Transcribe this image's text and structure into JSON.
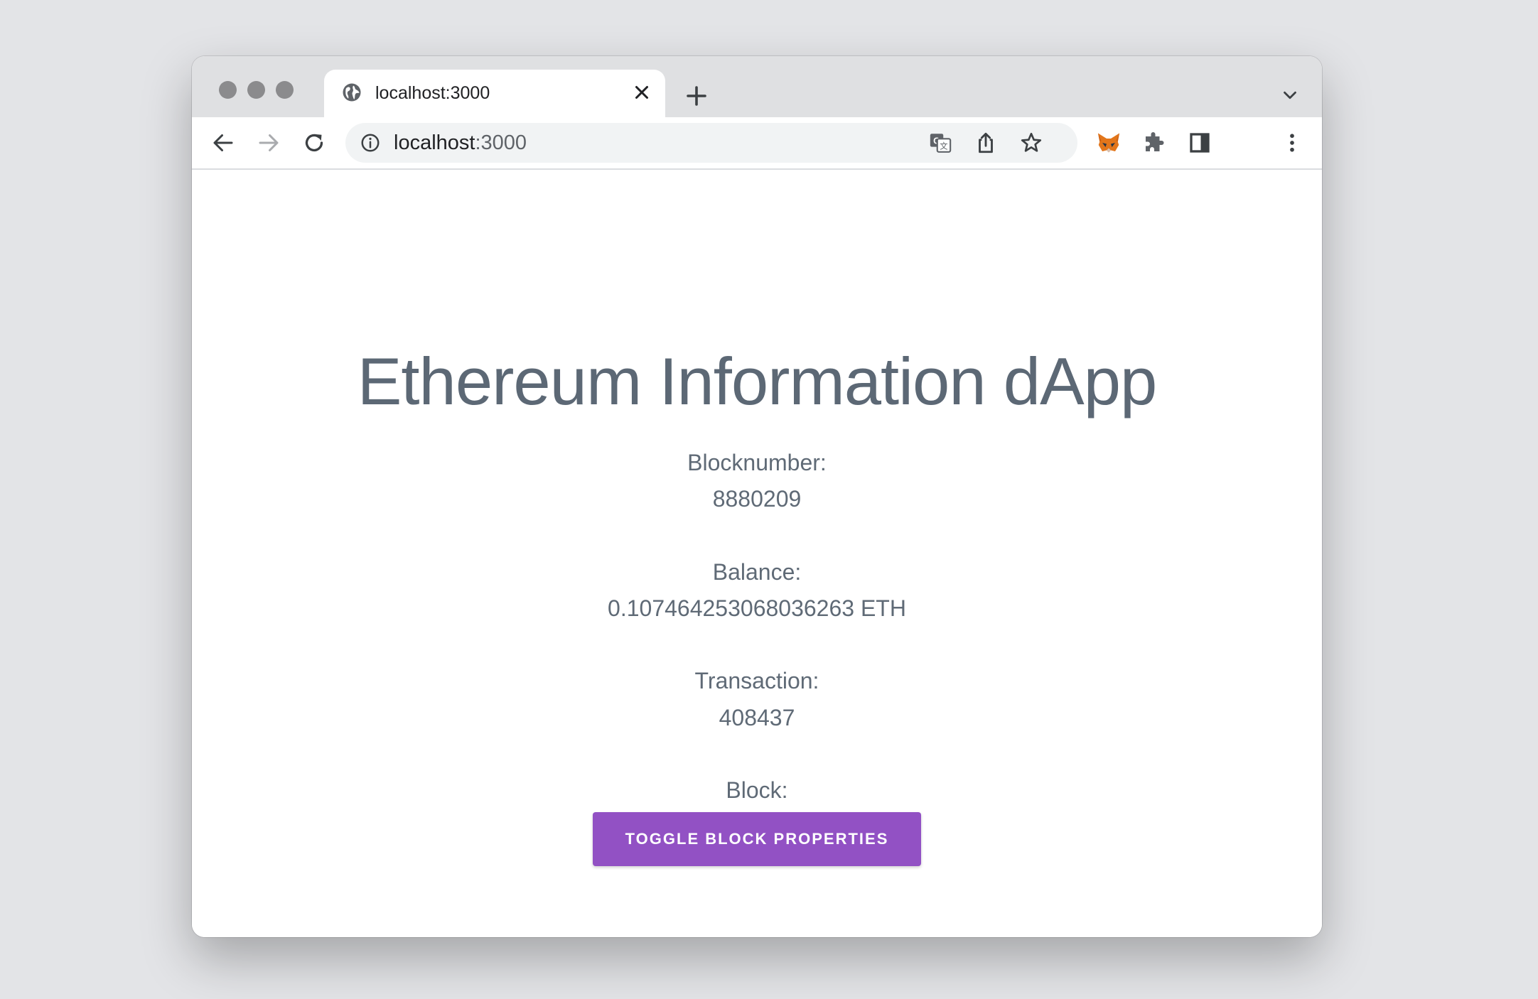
{
  "browser": {
    "tab": {
      "title": "localhost:3000",
      "icon": "globe-icon"
    },
    "new_tab_icon": "plus-icon",
    "tab_menu_icon": "chevron-down-icon",
    "nav": {
      "back_icon": "back-arrow-icon",
      "forward_icon": "forward-arrow-icon",
      "reload_icon": "reload-icon"
    },
    "omnibox": {
      "host": "localhost",
      "port": ":3000",
      "info_icon": "info-icon",
      "actions": [
        "translate-icon",
        "share-icon",
        "bookmark-star-icon"
      ]
    },
    "extensions": [
      "metamask-fox-icon",
      "puzzle-extensions-icon",
      "side-panel-icon",
      "more-menu-icon"
    ]
  },
  "page": {
    "title": "Ethereum Information dApp",
    "blocknumber_label": "Blocknumber:",
    "blocknumber_value": "8880209",
    "balance_label": "Balance:",
    "balance_value": "0.107464253068036263 ETH",
    "transaction_label": "Transaction:",
    "transaction_value": "408437",
    "block_label": "Block:",
    "toggle_button_label": "TOGGLE BLOCK PROPERTIES"
  },
  "colors": {
    "button": "#9251c4",
    "text": "#5f6a76",
    "background": "#e3e4e7"
  }
}
